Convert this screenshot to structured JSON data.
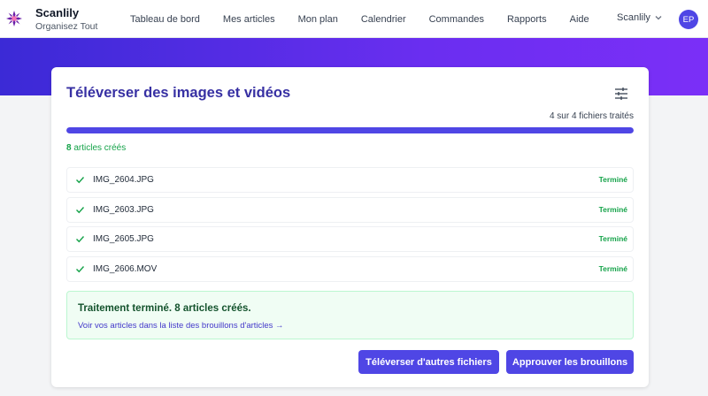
{
  "brand": {
    "name": "Scanlily",
    "tagline": "Organisez Tout",
    "logo": "flower-logo-icon"
  },
  "nav": {
    "items": [
      {
        "label": "Tableau de bord"
      },
      {
        "label": "Mes articles"
      },
      {
        "label": "Mon plan"
      },
      {
        "label": "Calendrier"
      },
      {
        "label": "Commandes"
      },
      {
        "label": "Rapports"
      },
      {
        "label": "Aide"
      }
    ],
    "user": "Scanlily",
    "avatar": "EP"
  },
  "upload": {
    "title": "Téléverser des images et vidéos",
    "progress_text": "4 sur 4 fichiers traités",
    "progress_fraction": 1.0,
    "created_count": "8",
    "created_label": " articles créés",
    "files": [
      {
        "name": "IMG_2604.JPG",
        "status": "Terminé"
      },
      {
        "name": "IMG_2603.JPG",
        "status": "Terminé"
      },
      {
        "name": "IMG_2605.JPG",
        "status": "Terminé"
      },
      {
        "name": "IMG_2606.MOV",
        "status": "Terminé"
      }
    ],
    "success_title": "Traitement terminé. 8 articles créés.",
    "success_link": "Voir vos articles dans la liste des brouillons d'articles →",
    "upload_more_button": "Téléverser d'autres fichiers",
    "approve_button": "Approuver les brouillons"
  },
  "colors": {
    "accent": "#4f46e5",
    "title": "#3730a3",
    "success": "#16a34a",
    "gradient_start": "#3b2ad6",
    "gradient_end": "#7b2ff7"
  }
}
